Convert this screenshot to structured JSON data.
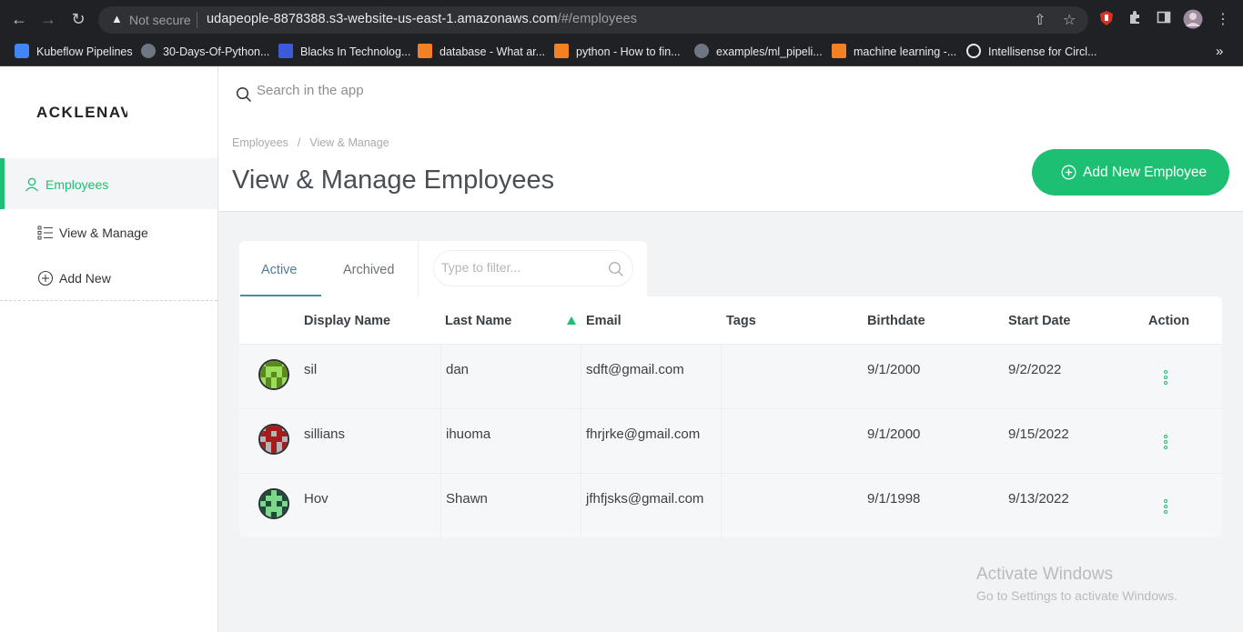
{
  "browser": {
    "security_label": "Not secure",
    "url_host": "udapeople-8878388.s3-website-us-east-1.amazonaws.com",
    "url_path": "/#/employees",
    "bookmarks": [
      {
        "label": "Kubeflow Pipelines",
        "color": "#4285f4"
      },
      {
        "label": "30-Days-Of-Python...",
        "color": "#6e7681"
      },
      {
        "label": "Blacks In Technolog...",
        "color": "#3b5bdb"
      },
      {
        "label": "database - What ar...",
        "color": "#f48024"
      },
      {
        "label": "python - How to fin...",
        "color": "#f48024"
      },
      {
        "label": "examples/ml_pipeli...",
        "color": "#6e7681"
      },
      {
        "label": "machine learning -...",
        "color": "#f48024"
      },
      {
        "label": "Intellisense for Circl...",
        "color": "#e8eaed"
      }
    ]
  },
  "sidebar": {
    "logo": "ACKLENAVENUE",
    "items": [
      {
        "label": "Employees",
        "icon": "user-icon",
        "active": true
      },
      {
        "label": "View & Manage",
        "icon": "list-icon",
        "active": false
      },
      {
        "label": "Add New",
        "icon": "plus-circle-icon",
        "active": false
      }
    ]
  },
  "header": {
    "search_placeholder": "Search in the app",
    "breadcrumb": [
      "Employees",
      "View & Manage"
    ],
    "title": "View & Manage Employees",
    "add_button_label": "Add New Employee"
  },
  "tabs": {
    "items": [
      "Active",
      "Archived"
    ],
    "active": "Active",
    "filter_placeholder": "Type to filter..."
  },
  "table": {
    "columns": [
      "Display Name",
      "Last Name",
      "Email",
      "Tags",
      "Birthdate",
      "Start Date",
      "Action"
    ],
    "rows": [
      {
        "display_name": "sil",
        "last_name": "dan",
        "email": "sdft@gmail.com",
        "tags": "",
        "birthdate": "9/1/2000",
        "start_date": "9/2/2022",
        "avatar_color": "#5a8a1e",
        "avatar_bg": "#9bdc5a"
      },
      {
        "display_name": "sillians",
        "last_name": "ihuoma",
        "email": "fhrjrke@gmail.com",
        "tags": "",
        "birthdate": "9/1/2000",
        "start_date": "9/15/2022",
        "avatar_color": "#a51c1c",
        "avatar_bg": "#b5b5b5"
      },
      {
        "display_name": "Hov",
        "last_name": "Shawn",
        "email": "jfhfjsks@gmail.com",
        "tags": "",
        "birthdate": "9/1/1998",
        "start_date": "9/13/2022",
        "avatar_color": "#1d6b4a",
        "avatar_bg": "#7cd98a"
      }
    ]
  },
  "overlay": {
    "activate_title": "Activate Windows",
    "activate_sub": "Go to Settings to activate Windows."
  },
  "colors": {
    "accent": "#1dbf73",
    "tab_active": "#4a7f9a"
  }
}
